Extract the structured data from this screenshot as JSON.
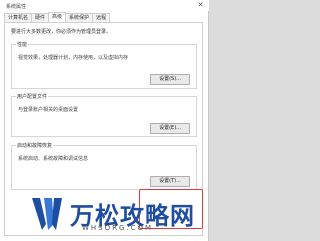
{
  "window": {
    "title": "系统属性",
    "close_label": "✕"
  },
  "tabs": [
    {
      "label": "计算机名",
      "active": false
    },
    {
      "label": "硬件",
      "active": false
    },
    {
      "label": "高级",
      "active": true
    },
    {
      "label": "系统保护",
      "active": false
    },
    {
      "label": "远程",
      "active": false
    }
  ],
  "panel": {
    "admin_note": "要进行大多数更改，你必须作为管理员登录。",
    "performance": {
      "title": "性能",
      "desc": "视觉效果，处理器计划，内存使用，以及虚拟内存",
      "button": "设置(S)..."
    },
    "user_profiles": {
      "title": "用户配置文件",
      "desc": "与登录账户相关的桌面设置",
      "button": "设置(E)..."
    },
    "startup_recovery": {
      "title": "启动和故障恢复",
      "desc": "系统启动、系统故障和调试信息",
      "button": "设置(T)..."
    }
  },
  "watermark": {
    "main": "万松攻略网",
    "sub": "WHSORG.COM"
  },
  "colors": {
    "highlight": "#e23b3b",
    "watermark": "#1f4da0"
  }
}
